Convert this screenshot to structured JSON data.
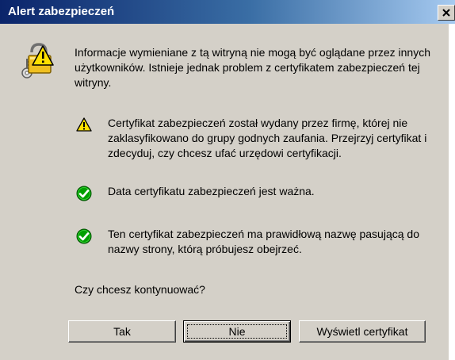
{
  "window": {
    "title": "Alert zabezpieczeń",
    "close_glyph": "✕"
  },
  "intro": {
    "text": "Informacje wymieniane z tą witryną nie mogą być oglądane przez innych użytkowników. Istnieje jednak problem z certyfikatem zabezpieczeń tej witryny.",
    "icon": "padlock-warning-icon"
  },
  "items": [
    {
      "status": "warning",
      "icon": "warning-triangle-icon",
      "text": "Certyfikat zabezpieczeń został wydany przez firmę, której nie zaklasyfikowano do grupy godnych zaufania. Przejrzyj certyfikat i zdecyduj, czy chcesz ufać urzędowi certyfikacji."
    },
    {
      "status": "ok",
      "icon": "check-circle-icon",
      "text": "Data certyfikatu zabezpieczeń jest ważna."
    },
    {
      "status": "ok",
      "icon": "check-circle-icon",
      "text": "Ten certyfikat zabezpieczeń ma prawidłową nazwę pasującą do nazwy strony, którą próbujesz obejrzeć."
    }
  ],
  "question": "Czy chcesz kontynuować?",
  "buttons": {
    "yes": "Tak",
    "no": "Nie",
    "view_certificate": "Wyświetl certyfikat"
  },
  "colors": {
    "title_gradient_start": "#0a246a",
    "title_gradient_end": "#a6caf0",
    "dialog_face": "#d4d0c8",
    "warning_yellow": "#ffe000",
    "ok_green": "#00a000"
  }
}
